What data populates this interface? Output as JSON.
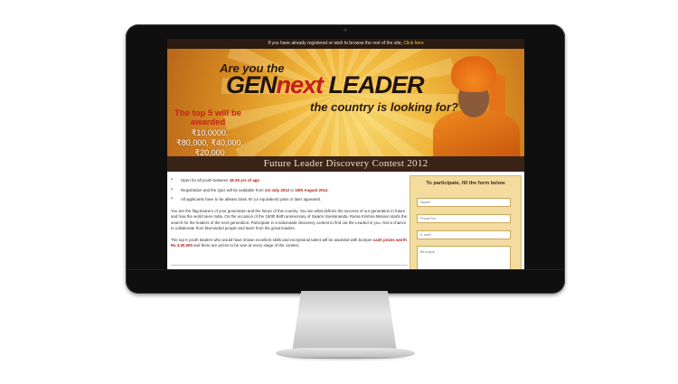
{
  "topbar": {
    "text": "If you have already registered or wish to browse the rest of the site,",
    "link": "Click here"
  },
  "banner": {
    "line1": "Are you the",
    "line2_a": "GEN",
    "line2_b": "next",
    "line2_c": " LEADER",
    "line3": "the country is looking for?",
    "prize_heading": "The top 5 will be awarded",
    "prize_values": [
      "₹10,0000,",
      "₹80,000, ₹40,000,",
      "₹20,000"
    ],
    "title": "Future Leader Discovery Contest 2012"
  },
  "bullets": [
    {
      "pre": "Open for all youth between ",
      "hl": "18-25 yrs of age",
      "post": ""
    },
    {
      "pre": "Registration and the Quiz will be available from ",
      "hl": "1st July 2012",
      "mid": " to ",
      "hl2": "15th August 2012",
      "post": "."
    },
    {
      "pre": "All applicants have to be atleast class XII (or equivalent) pass or later appeared.",
      "hl": "",
      "post": ""
    }
  ],
  "paragraph1": "You are the flag-bearers of your generation and the future of this country. You are what defines the success of our generation in future and how the world sees India. On the occasion of the 150th Birth anniversary of Swami Vivekananda, Rama Krishna Mission starts the search for the leaders of the next generation. Participate in a nationwide discovery contest to find out the Leaded in you. Get a chance to collaborate from likeminded people and learn from the great leaders.",
  "paragraph2": {
    "pre": "The top 5 youth leaders who would have shown excellent skills and exceptional talent will be awarded with bumper ",
    "hl": "cash prizes worth Rs 3,00,000",
    "post": " and there are prizes to be won at every stage of the contest."
  },
  "form": {
    "title": "To participate, fill the form below",
    "name_placeholder": "Name*",
    "phone_placeholder": "Phone No",
    "email_placeholder": "E-mail*",
    "message_placeholder": "Message"
  },
  "colors": {
    "topbar_bg": "#2a1a12",
    "title_bar_bg": "#3a2418",
    "accent_red": "#b0201a",
    "form_bg": "#f2dca0"
  }
}
